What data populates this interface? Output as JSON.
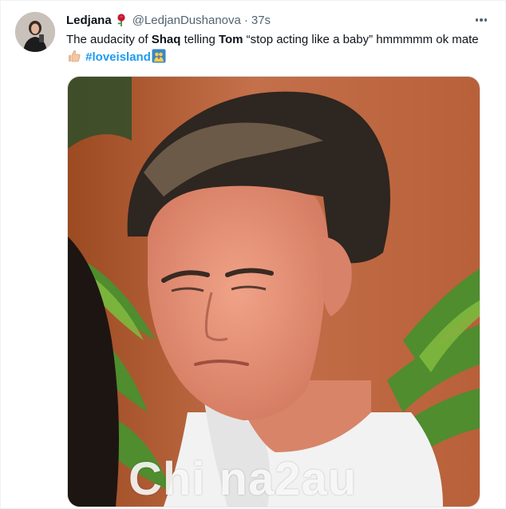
{
  "tweet": {
    "display_name": "Ledjana",
    "name_emoji": "rose-icon",
    "handle": "@LedjanDushanova",
    "separator": "·",
    "time": "37s",
    "text": {
      "part1": "The audacity of ",
      "shaq": "Shaq",
      "part2": " telling ",
      "tom": "Tom",
      "part3": " “stop acting like a baby” hmmmmm ok mate",
      "hashtag": "#loveisland"
    },
    "more_icon": "more-horizontal-icon",
    "media_description_icon": "photo"
  },
  "watermark": "Chi na2au",
  "colors": {
    "link": "#1d9bf0",
    "secondary_text": "#536471",
    "primary_text": "#0f1419"
  }
}
